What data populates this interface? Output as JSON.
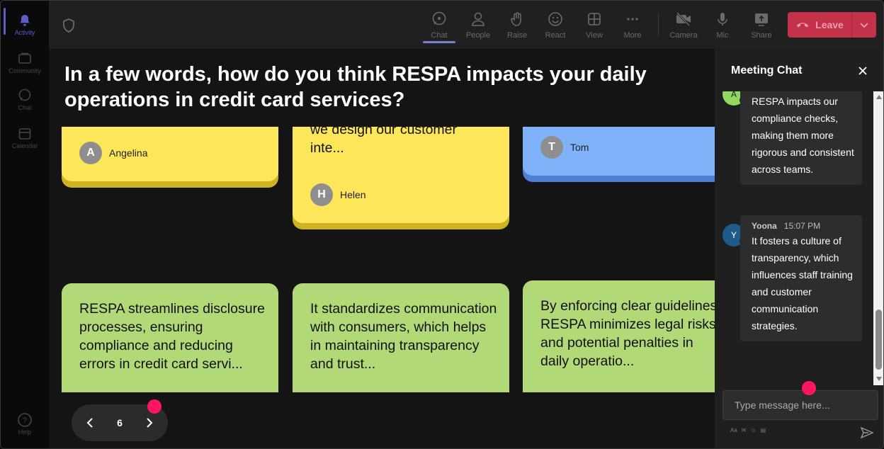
{
  "rail": {
    "items": [
      {
        "label": "Activity",
        "icon": "bell-icon"
      },
      {
        "label": "Community",
        "icon": "community-icon"
      },
      {
        "label": "Chat",
        "icon": "chat-icon"
      },
      {
        "label": "Calendar",
        "icon": "calendar-icon"
      }
    ],
    "help_label": "Help"
  },
  "toolbar": {
    "buttons": [
      {
        "label": "Chat",
        "icon": "chat-icon"
      },
      {
        "label": "People",
        "icon": "people-icon"
      },
      {
        "label": "Raise",
        "icon": "hand-icon"
      },
      {
        "label": "React",
        "icon": "smile-icon"
      },
      {
        "label": "View",
        "icon": "grid-icon"
      },
      {
        "label": "More",
        "icon": "more-icon"
      },
      {
        "label": "Camera",
        "icon": "camera-off-icon"
      },
      {
        "label": "Mic",
        "icon": "mic-icon"
      },
      {
        "label": "Share",
        "icon": "share-icon"
      }
    ],
    "leave_label": "Leave",
    "leave_color": "#c4314b"
  },
  "stage": {
    "question": "In a few words, how do you think RESPA impacts your daily operations in credit card services?",
    "cards": [
      {
        "text": "",
        "author": "Angelina",
        "initial": "A",
        "color": "#fde65a"
      },
      {
        "text": "we design our customer inte...",
        "author": "Helen",
        "initial": "H",
        "color": "#fde65a"
      },
      {
        "text": "",
        "author": "Tom",
        "initial": "T",
        "color": "#80b2f9"
      },
      {
        "text": "RESPA streamlines disclosure processes, ensuring compliance and reducing errors in credit card servi...",
        "author": "",
        "initial": "",
        "color": "#b2d977"
      },
      {
        "text": "It standardizes communication with consumers, which helps in maintaining transparency and trust...",
        "author": "",
        "initial": "",
        "color": "#b2d977"
      },
      {
        "text": "By enforcing clear guidelines, RESPA minimizes legal risks and potential penalties in daily operatio...",
        "author": "",
        "initial": "",
        "color": "#b2d977"
      }
    ],
    "page_number": "6"
  },
  "chat": {
    "title": "Meeting Chat",
    "messages": [
      {
        "author": "",
        "time": "",
        "initial": "A",
        "avatar_color": "#90d860",
        "text": "RESPA impacts our compliance checks, making them more rigorous and consistent across teams."
      },
      {
        "author": "Yoona",
        "time": "15:07 PM",
        "initial": "Y",
        "avatar_color": "#1e5a8a",
        "text": "It fosters a culture of transparency, which influences staff training and customer communication strategies."
      }
    ],
    "input_placeholder": "Type message here...",
    "format_icons": [
      "Aa",
      "✉",
      "☺",
      "▤"
    ]
  },
  "accent_color": "#ff1560"
}
